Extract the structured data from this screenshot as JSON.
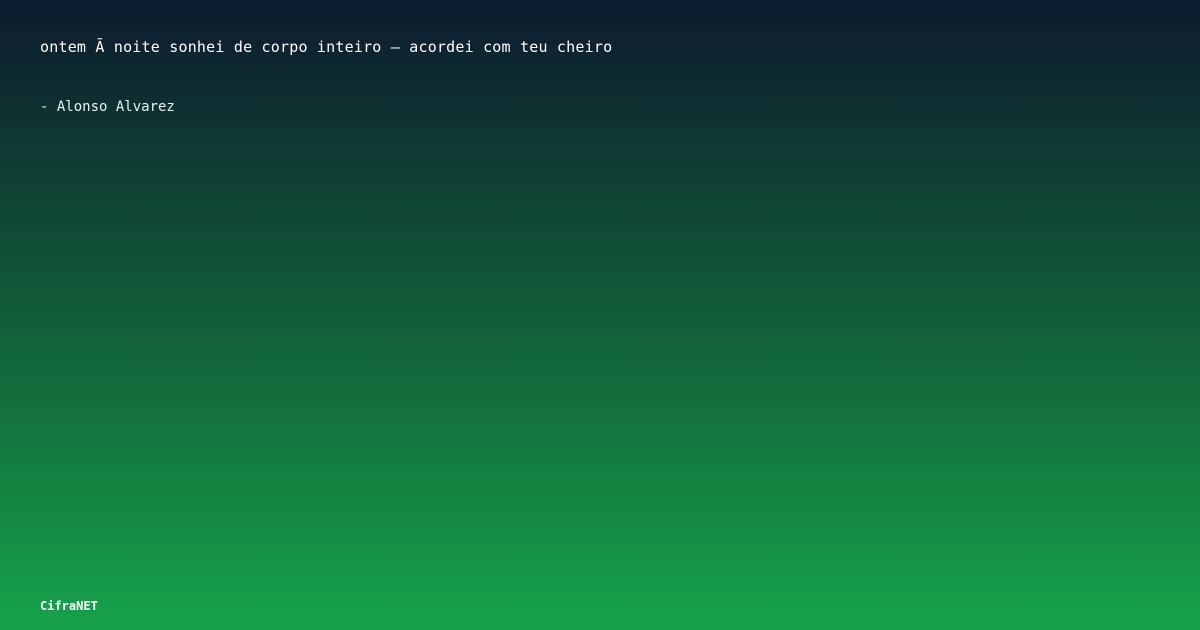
{
  "quote": {
    "text": "ontem Ã  noite sonhei de corpo inteiro – acordei com teu cheiro"
  },
  "author": {
    "text": "- Alonso Alvarez"
  },
  "brand": {
    "name": "CifraNET"
  },
  "colors": {
    "gradient_top": "#0d1a2e",
    "gradient_bottom": "#16a34a",
    "text": "#ffffff"
  }
}
